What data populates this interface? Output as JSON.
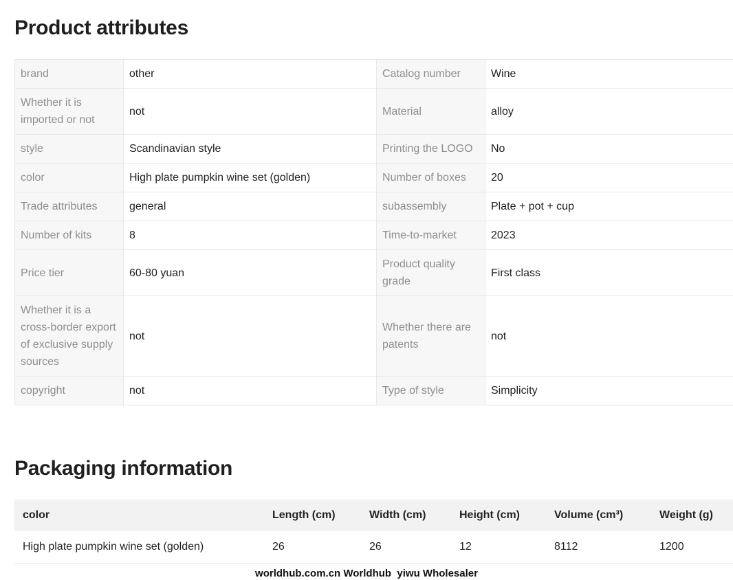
{
  "attributes": {
    "heading": "Product attributes",
    "rows": [
      {
        "k1": "brand",
        "v1": "other",
        "k2": "Catalog number",
        "v2": "Wine"
      },
      {
        "k1": "Whether it is imported or not",
        "v1": "not",
        "k2": "Material",
        "v2": "alloy"
      },
      {
        "k1": "style",
        "v1": "Scandinavian style",
        "k2": "Printing the LOGO",
        "v2": "No"
      },
      {
        "k1": "color",
        "v1": "High plate pumpkin wine set (golden)",
        "k2": "Number of boxes",
        "v2": "20"
      },
      {
        "k1": "Trade attributes",
        "v1": "general",
        "k2": "subassembly",
        "v2": "Plate + pot + cup"
      },
      {
        "k1": "Number of kits",
        "v1": "8",
        "k2": "Time-to-market",
        "v2": "2023"
      },
      {
        "k1": "Price tier",
        "v1": "60-80 yuan",
        "k2": "Product quality grade",
        "v2": "First class"
      },
      {
        "k1": "Whether it is a cross-border export of exclusive supply sources",
        "v1": "not",
        "k2": "Whether there are patents",
        "v2": "not"
      },
      {
        "k1": "copyright",
        "v1": "not",
        "k2": "Type of style",
        "v2": "Simplicity"
      }
    ]
  },
  "packaging": {
    "heading": "Packaging information",
    "columns": [
      "color",
      "Length (cm)",
      "Width (cm)",
      "Height (cm)",
      "Volume (cm³)",
      "Weight (g)"
    ],
    "rows": [
      [
        "High plate pumpkin wine set (golden)",
        "26",
        "26",
        "12",
        "8112",
        "1200"
      ]
    ]
  },
  "footer": {
    "text": "worldhub.com.cn Worldhub  yiwu Wholesaler"
  }
}
